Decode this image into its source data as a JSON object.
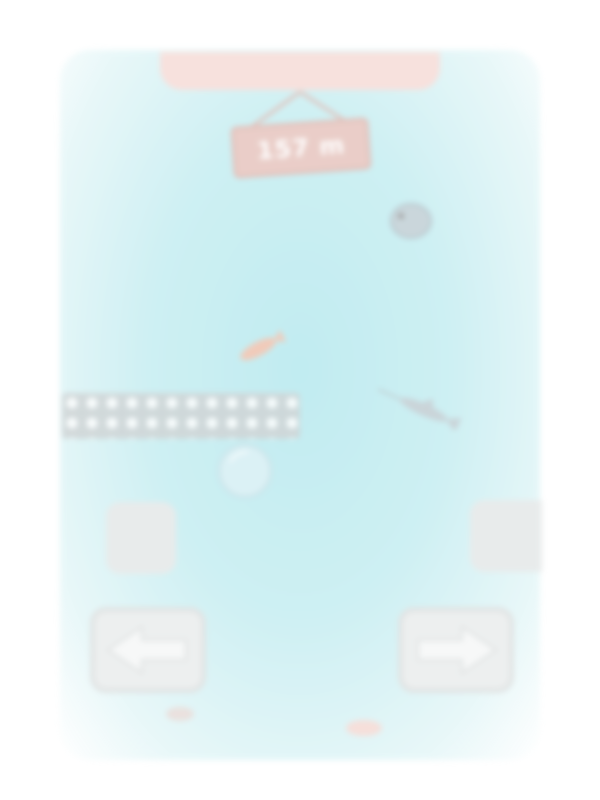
{
  "hud": {
    "depth_value": "157 m"
  },
  "controls": {
    "left_icon": "arrow-left-icon",
    "right_icon": "arrow-right-icon"
  },
  "colors": {
    "water": "#a7e4ea",
    "sign": "#d9a69c",
    "net": "#aab3b5",
    "button": "#dfe3e3"
  }
}
